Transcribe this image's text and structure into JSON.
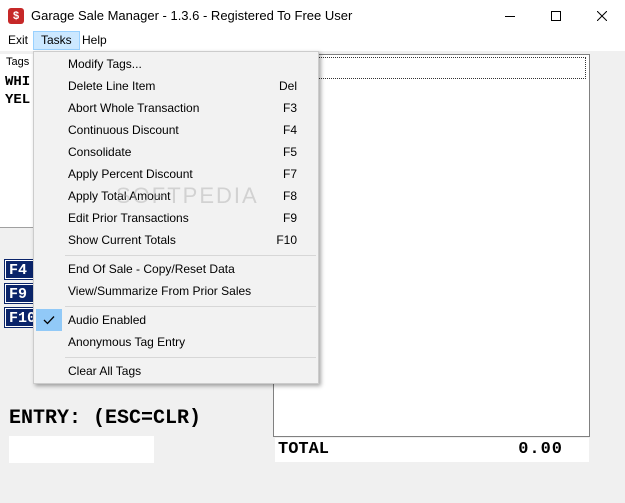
{
  "window": {
    "title": "Garage Sale Manager - 1.3.6 - Registered To Free User",
    "icon_glyph": "$"
  },
  "menubar": {
    "items": [
      "Exit",
      "Tasks",
      "Help"
    ]
  },
  "tags_panel": {
    "label": "Tags",
    "lines": [
      "WHI",
      "YEL"
    ]
  },
  "fkeys": [
    "F4",
    "F9",
    "F10"
  ],
  "tasks_menu": {
    "items": [
      {
        "label": "Modify Tags...",
        "key": ""
      },
      {
        "label": "Delete Line Item",
        "key": "Del"
      },
      {
        "label": "Abort Whole Transaction",
        "key": "F3"
      },
      {
        "label": "Continuous Discount",
        "key": "F4"
      },
      {
        "label": "Consolidate",
        "key": "F5"
      },
      {
        "label": "Apply Percent Discount",
        "key": "F7"
      },
      {
        "label": "Apply Total Amount",
        "key": "F8"
      },
      {
        "label": "Edit Prior Transactions",
        "key": "F9"
      },
      {
        "label": "Show Current Totals",
        "key": "F10"
      },
      {
        "label": "End Of Sale - Copy/Reset Data",
        "key": ""
      },
      {
        "label": "View/Summarize From Prior Sales",
        "key": ""
      },
      {
        "label": "Audio Enabled",
        "key": "",
        "checked": true
      },
      {
        "label": "Anonymous Tag Entry",
        "key": ""
      },
      {
        "label": "Clear All Tags",
        "key": ""
      }
    ]
  },
  "entry": {
    "label": "ENTRY: (ESC=CLR)",
    "value": ""
  },
  "total": {
    "label": "TOTAL",
    "value": "0.00"
  },
  "watermark": "SOFTPEDIA",
  "colors": {
    "menu_highlight": "#cce8ff",
    "fkey_bg": "#0a246a",
    "check_bg": "#91c9f7"
  }
}
